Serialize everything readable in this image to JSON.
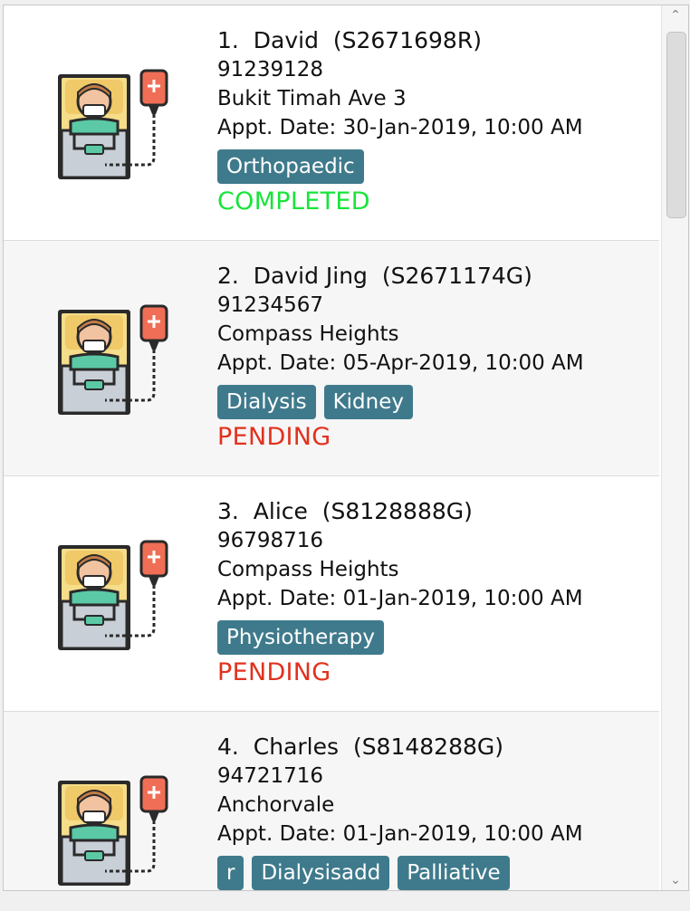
{
  "persons": [
    {
      "index": "1.",
      "name": "David",
      "nric": "(S2671698R)",
      "phone": "91239128",
      "address": "Bukit Timah Ave 3",
      "appointment": "Appt. Date: 30-Jan-2019, 10:00 AM",
      "tags": [
        "Orthopaedic"
      ],
      "status": "COMPLETED"
    },
    {
      "index": "2.",
      "name": "David Jing",
      "nric": "(S2671174G)",
      "phone": "91234567",
      "address": "Compass Heights",
      "appointment": "Appt. Date: 05-Apr-2019, 10:00 AM",
      "tags": [
        "Dialysis",
        "Kidney"
      ],
      "status": "PENDING"
    },
    {
      "index": "3.",
      "name": "Alice",
      "nric": "(S8128888G)",
      "phone": "96798716",
      "address": "Compass Heights",
      "appointment": "Appt. Date: 01-Jan-2019, 10:00 AM",
      "tags": [
        "Physiotherapy"
      ],
      "status": "PENDING"
    },
    {
      "index": "4.",
      "name": "Charles",
      "nric": "(S8148288G)",
      "phone": "94721716",
      "address": "Anchorvale",
      "appointment": "Appt. Date: 01-Jan-2019, 10:00 AM",
      "tags": [
        "r",
        "Dialysisadd",
        "Palliative"
      ],
      "status": ""
    }
  ],
  "icons": {
    "avatar": "patient-bed-icon",
    "scroll_up": "chevron-up-icon",
    "scroll_down": "chevron-down-icon"
  },
  "colors": {
    "tag_bg": "#3f7a8c",
    "completed": "#18e43a",
    "pending": "#e2311d"
  },
  "scrollbar": {
    "up_glyph": "⌃",
    "down_glyph": "⌄"
  }
}
